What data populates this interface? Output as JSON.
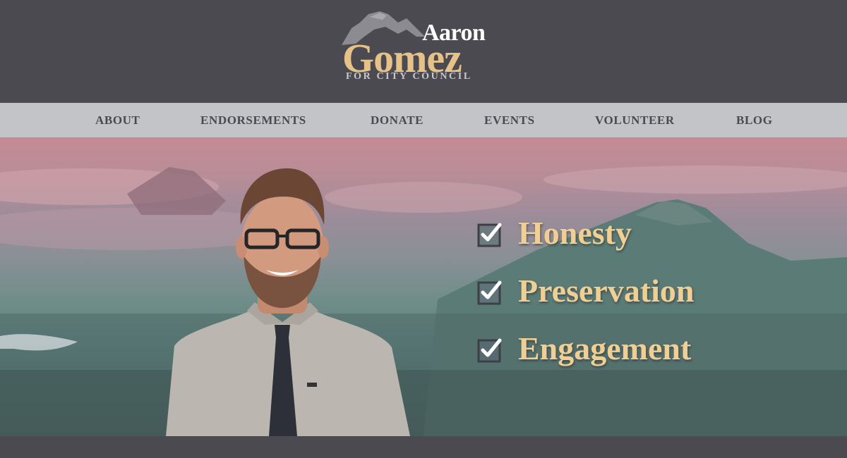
{
  "header": {
    "logo": {
      "first_name": "Aaron",
      "last_name": "Gomez",
      "tagline": "FOR CITY COUNCIL"
    }
  },
  "nav": {
    "items": [
      {
        "label": "ABOUT"
      },
      {
        "label": "ENDORSEMENTS"
      },
      {
        "label": "DONATE"
      },
      {
        "label": "EVENTS"
      },
      {
        "label": "VOLUNTEER"
      },
      {
        "label": "BLOG"
      }
    ]
  },
  "hero": {
    "values": [
      {
        "label": "Honesty",
        "icon": "checkbox-checked-icon"
      },
      {
        "label": "Preservation",
        "icon": "checkbox-checked-icon"
      },
      {
        "label": "Engagement",
        "icon": "checkbox-checked-icon"
      }
    ]
  },
  "colors": {
    "header_bg": "#4b4a50",
    "nav_bg": "#c3c4c7",
    "nav_text": "#4a494f",
    "accent_gold": "#e6c289"
  }
}
